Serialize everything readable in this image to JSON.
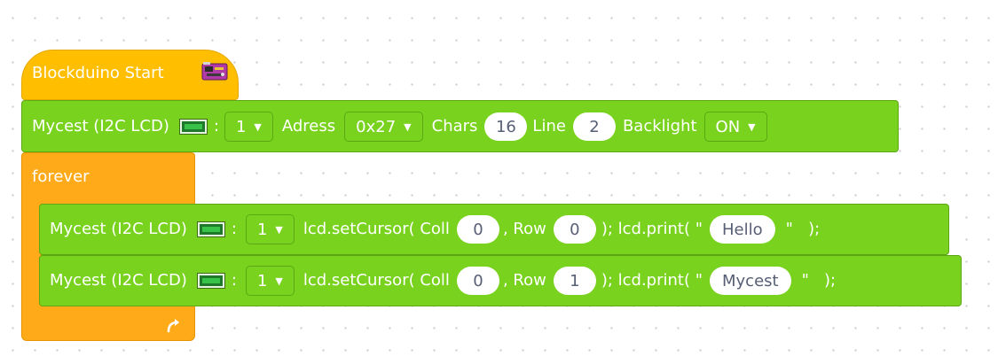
{
  "start_block": {
    "label": "Blockduino Start",
    "icon": "arduino-board-icon"
  },
  "lcd_setup": {
    "prefix": "Mycest (I2C LCD)",
    "colon": ":",
    "lcd_id": "1",
    "adress_label": "Adress",
    "adress_value": "0x27",
    "chars_label": "Chars",
    "chars_value": "16",
    "line_label": "Line",
    "line_value": "2",
    "backlight_label": "Backlight",
    "backlight_value": "ON"
  },
  "forever": {
    "label": "forever",
    "loop_icon": "loop-arrow-icon"
  },
  "print_blocks": [
    {
      "prefix": "Mycest (I2C LCD)",
      "colon": ":",
      "lcd_id": "1",
      "set_cursor": "lcd.setCursor( Coll",
      "col_value": "0",
      "row_label": ", Row",
      "row_value": "0",
      "print_label": "); lcd.print( \"",
      "text": "Hello",
      "end": "\"   );"
    },
    {
      "prefix": "Mycest (I2C LCD)",
      "colon": ":",
      "lcd_id": "1",
      "set_cursor": "lcd.setCursor( Coll",
      "col_value": "0",
      "row_label": ", Row",
      "row_value": "1",
      "print_label": "); lcd.print( \"",
      "text": "Mycest",
      "end": "\"   );"
    }
  ],
  "colors": {
    "hat_yellow": "#ffbf00",
    "control_orange": "#ffab19",
    "lcd_green": "#79d21e"
  }
}
